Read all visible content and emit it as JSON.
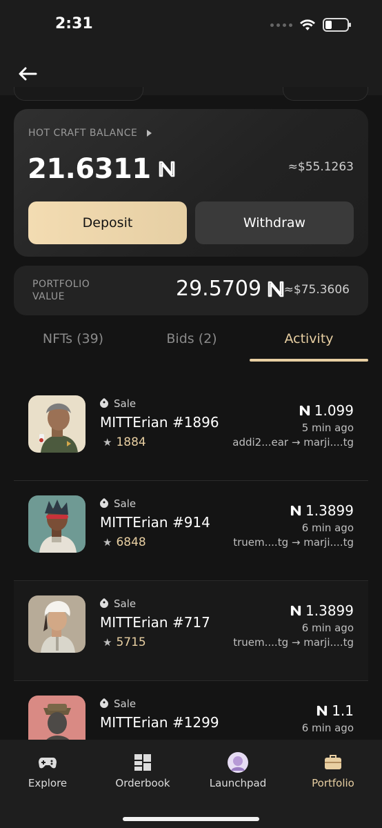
{
  "status_bar": {
    "time": "2:31"
  },
  "balance": {
    "label": "HOT CRAFT BALANCE",
    "amount": "21.6311",
    "usd": "≈$55.1263",
    "deposit_label": "Deposit",
    "withdraw_label": "Withdraw"
  },
  "portfolio": {
    "label": "PORTFOLIO VALUE",
    "amount": "29.5709",
    "usd": "≈$75.3606"
  },
  "tabs": [
    {
      "label": "NFTs (39)",
      "active": false
    },
    {
      "label": "Bids (2)",
      "active": false
    },
    {
      "label": "Activity",
      "active": true
    }
  ],
  "activity": [
    {
      "type": "Sale",
      "name": "MITTErian #1896",
      "rank": "1884",
      "price": "1.099",
      "time": "5 min ago",
      "route": "addi2...ear → marji....tg"
    },
    {
      "type": "Sale",
      "name": "MITTErian #914",
      "rank": "6848",
      "price": "1.3899",
      "time": "6 min ago",
      "route": "truem....tg → marji....tg"
    },
    {
      "type": "Sale",
      "name": "MITTErian #717",
      "rank": "5715",
      "price": "1.3899",
      "time": "6 min ago",
      "route": "truem....tg → marji....tg"
    },
    {
      "type": "Sale",
      "name": "MITTErian #1299",
      "rank": "",
      "price": "1.1",
      "time": "6 min ago",
      "route": ""
    }
  ],
  "bottom_nav": [
    {
      "label": "Explore",
      "icon": "gamepad-icon",
      "active": false
    },
    {
      "label": "Orderbook",
      "icon": "grid-icon",
      "active": false
    },
    {
      "label": "Launchpad",
      "icon": "launchpad-avatar-icon",
      "active": false
    },
    {
      "label": "Portfolio",
      "icon": "briefcase-icon",
      "active": true
    }
  ],
  "colors": {
    "background": "#141414",
    "accent": "#e8cfa2",
    "deposit_button": "#f3dcb2",
    "withdraw_button": "#3a3a3a"
  }
}
